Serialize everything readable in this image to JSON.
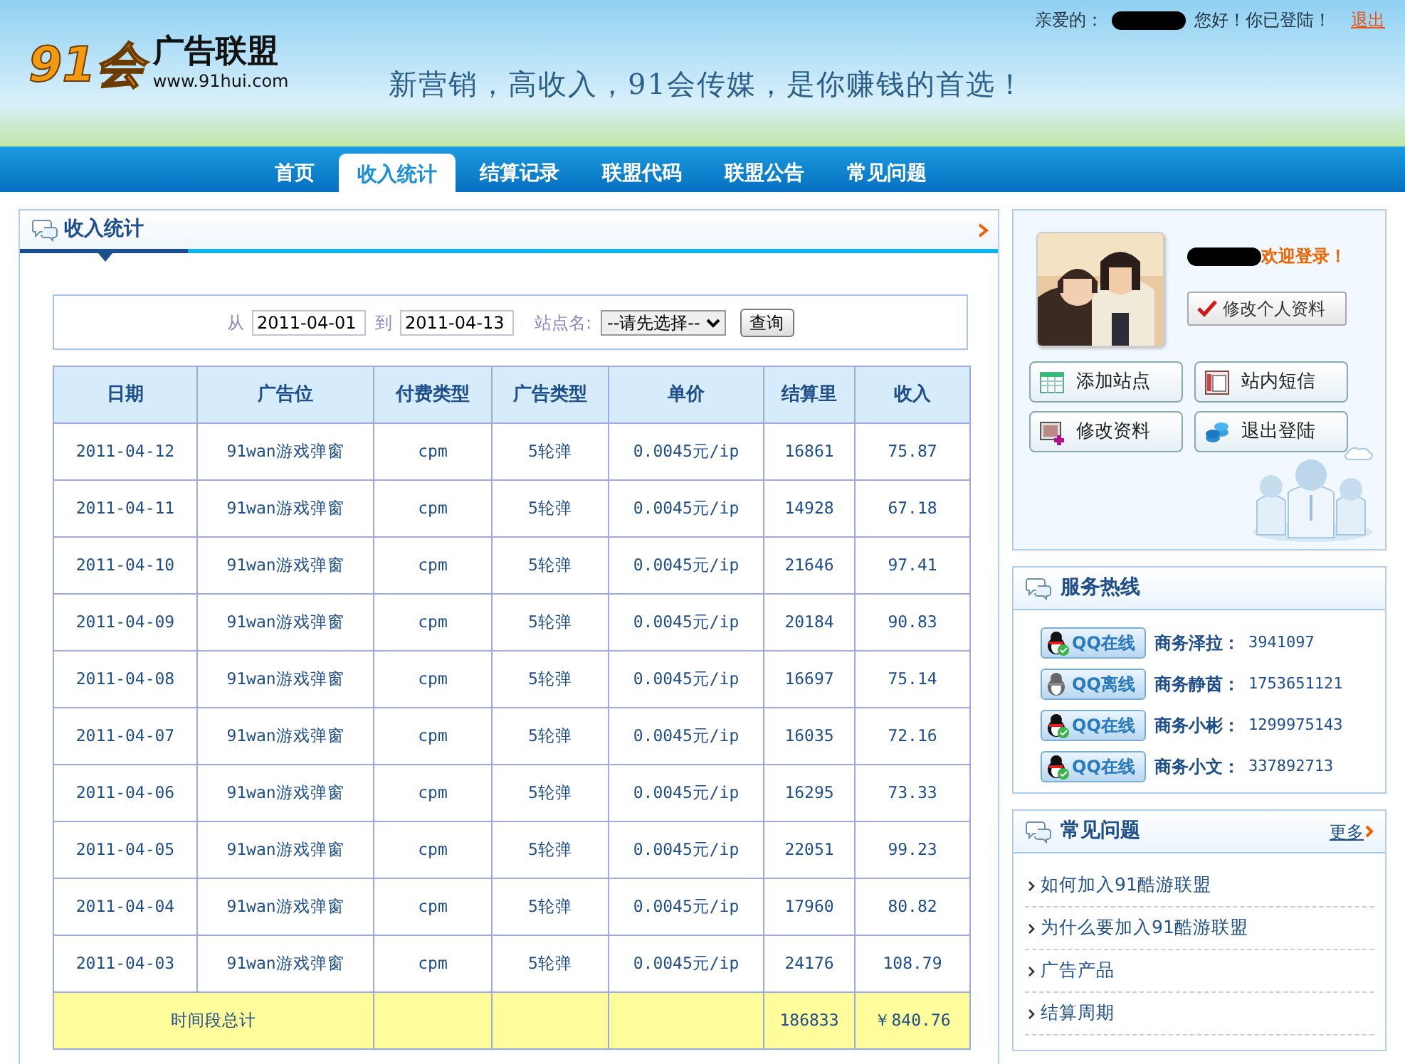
{
  "header": {
    "logo_mark": "91会",
    "logo_title": "广告联盟",
    "logo_url": "www.91hui.com",
    "slogan": "新营销，高收入，91会传媒，是你赚钱的首选！",
    "greeting": "亲爱的：",
    "greeting_after": "您好！你已登陆！",
    "logout": "退出"
  },
  "nav": [
    {
      "label": "首页",
      "selected": false
    },
    {
      "label": "收入统计",
      "selected": true
    },
    {
      "label": "结算记录",
      "selected": false
    },
    {
      "label": "联盟代码",
      "selected": false
    },
    {
      "label": "联盟公告",
      "selected": false
    },
    {
      "label": "常见问题",
      "selected": false
    }
  ],
  "main": {
    "title": "收入统计",
    "filter": {
      "from_label": "从",
      "from": "2011-04-01",
      "to_label": "到",
      "to": "2011-04-13",
      "site_label": "站点名:",
      "site_value": "--请先选择--",
      "button": "查询"
    },
    "table": {
      "columns": [
        "日期",
        "广告位",
        "付费类型",
        "广告类型",
        "单价",
        "结算里",
        "收入"
      ],
      "rows": [
        [
          "2011-04-12",
          "91wan游戏弹窗",
          "cpm",
          "5轮弹",
          "0.0045元/ip",
          "16861",
          "75.87"
        ],
        [
          "2011-04-11",
          "91wan游戏弹窗",
          "cpm",
          "5轮弹",
          "0.0045元/ip",
          "14928",
          "67.18"
        ],
        [
          "2011-04-10",
          "91wan游戏弹窗",
          "cpm",
          "5轮弹",
          "0.0045元/ip",
          "21646",
          "97.41"
        ],
        [
          "2011-04-09",
          "91wan游戏弹窗",
          "cpm",
          "5轮弹",
          "0.0045元/ip",
          "20184",
          "90.83"
        ],
        [
          "2011-04-08",
          "91wan游戏弹窗",
          "cpm",
          "5轮弹",
          "0.0045元/ip",
          "16697",
          "75.14"
        ],
        [
          "2011-04-07",
          "91wan游戏弹窗",
          "cpm",
          "5轮弹",
          "0.0045元/ip",
          "16035",
          "72.16"
        ],
        [
          "2011-04-06",
          "91wan游戏弹窗",
          "cpm",
          "5轮弹",
          "0.0045元/ip",
          "16295",
          "73.33"
        ],
        [
          "2011-04-05",
          "91wan游戏弹窗",
          "cpm",
          "5轮弹",
          "0.0045元/ip",
          "22051",
          "99.23"
        ],
        [
          "2011-04-04",
          "91wan游戏弹窗",
          "cpm",
          "5轮弹",
          "0.0045元/ip",
          "17960",
          "80.82"
        ],
        [
          "2011-04-03",
          "91wan游戏弹窗",
          "cpm",
          "5轮弹",
          "0.0045元/ip",
          "24176",
          "108.79"
        ]
      ],
      "total": {
        "label": "时间段总计",
        "volume": "186833",
        "income": "￥840.76"
      }
    }
  },
  "profile": {
    "welcome": "欢迎登录！",
    "edit_button": "修改个人资料",
    "actions": [
      {
        "label": "添加站点",
        "kind": "add-site"
      },
      {
        "label": "站内短信",
        "kind": "message"
      },
      {
        "label": "修改资料",
        "kind": "edit"
      },
      {
        "label": "退出登陆",
        "kind": "logout"
      }
    ]
  },
  "hotline": {
    "title": "服务热线",
    "contacts": [
      {
        "status": "QQ在线",
        "online": true,
        "name": "商务泽拉：",
        "qq": "3941097"
      },
      {
        "status": "QQ离线",
        "online": false,
        "name": "商务静茵：",
        "qq": "1753651121"
      },
      {
        "status": "QQ在线",
        "online": true,
        "name": "商务小彬：",
        "qq": "1299975143"
      },
      {
        "status": "QQ在线",
        "online": true,
        "name": "商务小文：",
        "qq": "337892713"
      }
    ]
  },
  "faq": {
    "title": "常见问题",
    "more": "更多",
    "items": [
      "如何加入91酷游联盟",
      "为什么要加入91酷游联盟",
      "广告产品",
      "结算周期"
    ]
  }
}
